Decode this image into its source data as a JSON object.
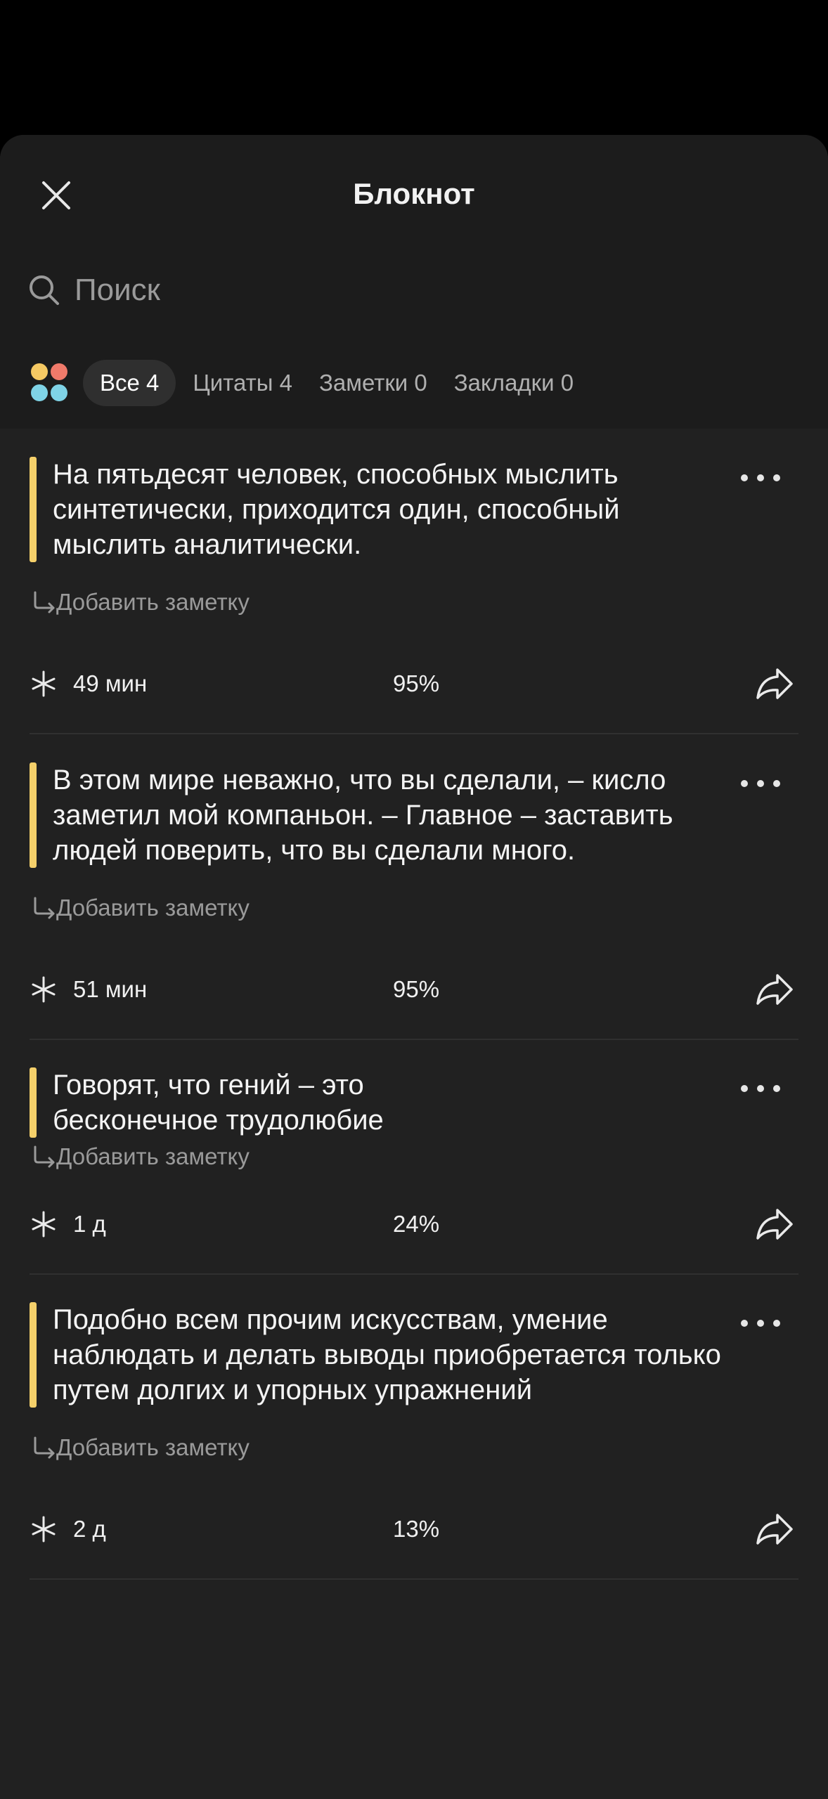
{
  "header": {
    "title": "Блокнот",
    "close_icon": "close-icon"
  },
  "search": {
    "placeholder": "Поиск",
    "icon": "search-icon"
  },
  "filters": {
    "dots_colors": [
      "#f5c963",
      "#f07a6a",
      "#7fd3e6",
      "#7fd3e6"
    ],
    "tabs": [
      {
        "label": "Все 4",
        "active": true
      },
      {
        "label": "Цитаты 4",
        "active": false
      },
      {
        "label": "Заметки 0",
        "active": false
      },
      {
        "label": "Закладки 0",
        "active": false
      }
    ]
  },
  "accent_color": "#f5d06a",
  "items": [
    {
      "quote": "На пятьдесят человек, способных мыслить синтетически, приходится один, способный мыслить аналитически.",
      "add_note": "Добавить заметку",
      "time": "49 мин",
      "progress": "95%"
    },
    {
      "quote": "В этом мире неважно, что вы сделали, – кисло заметил мой компаньон. – Главное – заставить людей поверить, что вы сделали много.",
      "add_note": "Добавить заметку",
      "time": "51 мин",
      "progress": "95%"
    },
    {
      "quote": "Говорят, что гений – это бесконечное трудолюбие",
      "add_note": "Добавить заметку",
      "time": "1 д",
      "progress": "24%"
    },
    {
      "quote": "Подобно всем прочим искусствам, умение наблюдать и делать выводы приобретается только путем долгих и упорных упражнений",
      "add_note": "Добавить заметку",
      "time": "2 д",
      "progress": "13%"
    }
  ]
}
